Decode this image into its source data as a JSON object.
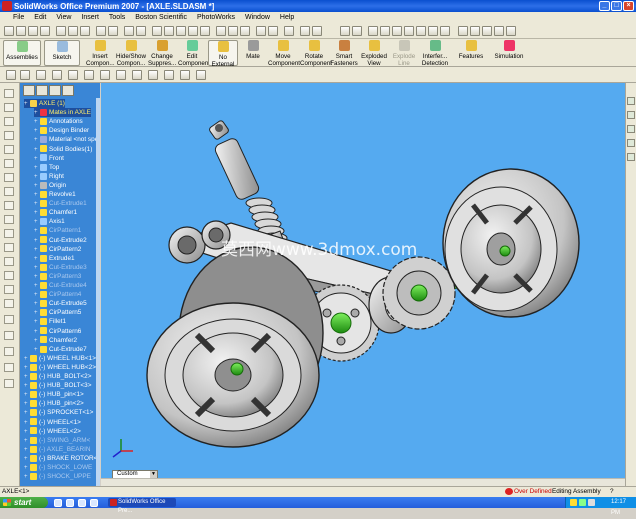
{
  "window": {
    "title": "SolidWorks Office Premium 2007 - [AXLE.SLDASM *]"
  },
  "menu": [
    "File",
    "Edit",
    "View",
    "Insert",
    "Tools",
    "Boston Scientific",
    "PhotoWorks",
    "Window",
    "Help"
  ],
  "command_manager": {
    "assemblies_label": "Assemblies",
    "sketch_label": "Sketch",
    "buttons": [
      {
        "label": "Insert Compon...",
        "icon": "insert-component-icon"
      },
      {
        "label": "Hide/Show Compon...",
        "icon": "hide-show-icon"
      },
      {
        "label": "Change Suppres...",
        "icon": "change-suppression-icon"
      },
      {
        "label": "Edit Component",
        "icon": "edit-component-icon"
      },
      {
        "label": "No External ...",
        "icon": "no-external-references-icon"
      },
      {
        "label": "Mate",
        "icon": "mate-icon"
      },
      {
        "label": "Move Component",
        "icon": "move-component-icon"
      },
      {
        "label": "Rotate Component",
        "icon": "rotate-component-icon"
      },
      {
        "label": "Smart Fasteners",
        "icon": "smart-fasteners-icon"
      },
      {
        "label": "Exploded View",
        "icon": "exploded-view-icon"
      },
      {
        "label": "Explode Line Sketch",
        "icon": "explode-line-sketch-icon"
      },
      {
        "label": "Interfer... Detection",
        "icon": "interference-detection-icon"
      },
      {
        "label": "Features",
        "icon": "features-icon"
      },
      {
        "label": "Simulation",
        "icon": "simulation-icon"
      }
    ]
  },
  "tree": {
    "items": [
      {
        "label": "AXLE (1)",
        "level": 0,
        "state": "selected",
        "icon_color": "#f5d24a"
      },
      {
        "label": "Mates in AXLE",
        "level": 1,
        "state": "selected",
        "icon_color": "#e34"
      },
      {
        "label": "Annotations",
        "level": 1,
        "state": "normal",
        "icon_color": "#fd3"
      },
      {
        "label": "Design Binder",
        "level": 1,
        "state": "normal",
        "icon_color": "#fd3"
      },
      {
        "label": "Material <not spe",
        "level": 1,
        "state": "normal",
        "icon_color": "#9ad"
      },
      {
        "label": "Solid Bodies(1)",
        "level": 1,
        "state": "normal",
        "icon_color": "#fd3"
      },
      {
        "label": "Front",
        "level": 1,
        "state": "normal",
        "icon_color": "#9cf"
      },
      {
        "label": "Top",
        "level": 1,
        "state": "normal",
        "icon_color": "#9cf"
      },
      {
        "label": "Right",
        "level": 1,
        "state": "normal",
        "icon_color": "#9cf"
      },
      {
        "label": "Origin",
        "level": 1,
        "state": "normal",
        "icon_color": "#bbb"
      },
      {
        "label": "Revolve1",
        "level": 1,
        "state": "normal",
        "icon_color": "#fd3"
      },
      {
        "label": "Cut-Extrude1",
        "level": 1,
        "state": "dim",
        "icon_color": "#fd3"
      },
      {
        "label": "Chamfer1",
        "level": 1,
        "state": "normal",
        "icon_color": "#fd3"
      },
      {
        "label": "Axis1",
        "level": 1,
        "state": "normal",
        "icon_color": "#9cf"
      },
      {
        "label": "CirPattern1",
        "level": 1,
        "state": "dim",
        "icon_color": "#fd3"
      },
      {
        "label": "Cut-Extrude2",
        "level": 1,
        "state": "normal",
        "icon_color": "#fd3"
      },
      {
        "label": "CirPattern2",
        "level": 1,
        "state": "normal",
        "icon_color": "#fd3"
      },
      {
        "label": "Extrude1",
        "level": 1,
        "state": "normal",
        "icon_color": "#fd3"
      },
      {
        "label": "Cut-Extrude3",
        "level": 1,
        "state": "dim",
        "icon_color": "#fd3"
      },
      {
        "label": "CirPattern3",
        "level": 1,
        "state": "dim",
        "icon_color": "#fd3"
      },
      {
        "label": "Cut-Extrude4",
        "level": 1,
        "state": "dim",
        "icon_color": "#fd3"
      },
      {
        "label": "CirPattern4",
        "level": 1,
        "state": "dim",
        "icon_color": "#fd3"
      },
      {
        "label": "Cut-Extrude5",
        "level": 1,
        "state": "normal",
        "icon_color": "#fd3"
      },
      {
        "label": "CirPattern5",
        "level": 1,
        "state": "normal",
        "icon_color": "#fd3"
      },
      {
        "label": "Fillet1",
        "level": 1,
        "state": "normal",
        "icon_color": "#fd3"
      },
      {
        "label": "CirPattern6",
        "level": 1,
        "state": "normal",
        "icon_color": "#fd3"
      },
      {
        "label": "Chamfer2",
        "level": 1,
        "state": "normal",
        "icon_color": "#fd3"
      },
      {
        "label": "Cut-Extrude7",
        "level": 1,
        "state": "normal",
        "icon_color": "#fd3"
      },
      {
        "label": "(-) WHEEL HUB<1>",
        "level": 0,
        "state": "normal",
        "icon_color": "#fd3"
      },
      {
        "label": "(-) WHEEL HUB<2>",
        "level": 0,
        "state": "normal",
        "icon_color": "#fd3"
      },
      {
        "label": "(-) HUB_BOLT<2>",
        "level": 0,
        "state": "normal",
        "icon_color": "#fd3"
      },
      {
        "label": "(-) HUB_BOLT<3>",
        "level": 0,
        "state": "normal",
        "icon_color": "#fd3"
      },
      {
        "label": "(-) HUB_pin<1>",
        "level": 0,
        "state": "normal",
        "icon_color": "#fd3"
      },
      {
        "label": "(-) HUB_pin<2>",
        "level": 0,
        "state": "normal",
        "icon_color": "#fd3"
      },
      {
        "label": "(-) SPROCKET<1>",
        "level": 0,
        "state": "normal",
        "icon_color": "#fd3"
      },
      {
        "label": "(-) WHEEL<1>",
        "level": 0,
        "state": "normal",
        "icon_color": "#fd3"
      },
      {
        "label": "(-) WHEEL<2>",
        "level": 0,
        "state": "normal",
        "icon_color": "#fd3"
      },
      {
        "label": "(-) SWING_ARM<",
        "level": 0,
        "state": "dim",
        "icon_color": "#fd3"
      },
      {
        "label": "(-) AXLE_BEARIN",
        "level": 0,
        "state": "dim",
        "icon_color": "#fd3"
      },
      {
        "label": "(-) BRAKE ROTOR<2>",
        "level": 0,
        "state": "normal",
        "icon_color": "#fd3"
      },
      {
        "label": "(-) SHOCK_LOWE",
        "level": 0,
        "state": "dim",
        "icon_color": "#fd3"
      },
      {
        "label": "(-) SHOCK_UPPE",
        "level": 0,
        "state": "dim",
        "icon_color": "#fd3"
      }
    ]
  },
  "viewport": {
    "watermark": "莫西网www.3dmox.com",
    "view_orientation": "Custom",
    "background_color": "#55aaf0"
  },
  "status": {
    "left": "AXLE<1>",
    "definition": "Over Defined",
    "mode": "Editing Assembly",
    "help": "?"
  },
  "taskbar": {
    "start_label": "start",
    "item_label": "SolidWorks Office Pre...",
    "clock": "12:17 PM"
  },
  "colors": {
    "title_blue": "#0a4fcf",
    "tree_blue": "#3a86d6",
    "viewport_blue": "#55aaf0",
    "part_green": "#3fd12a",
    "part_gray": "#c9c9c9"
  }
}
